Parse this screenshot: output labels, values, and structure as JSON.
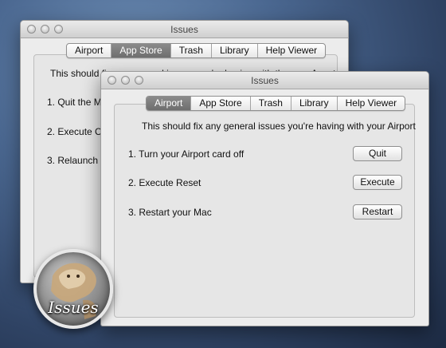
{
  "window_title": "Issues",
  "tabs": [
    "Airport",
    "App Store",
    "Trash",
    "Library",
    "Help Viewer"
  ],
  "back_window": {
    "selected_tab": "App Store",
    "description": "This should fix any general issues you're having with the mac Appstore",
    "steps": [
      "1.  Quit the Mac",
      "2.  Execute Con",
      "3.  Relaunch M"
    ]
  },
  "front_window": {
    "selected_tab": "Airport",
    "description": "This should fix any general issues you're having with your Airport",
    "steps": [
      {
        "label": "1.  Turn your Airport card off",
        "button": "Quit"
      },
      {
        "label": "2.  Execute Reset",
        "button": "Execute"
      },
      {
        "label": "3.  Restart your Mac",
        "button": "Restart"
      }
    ]
  },
  "app_icon": {
    "label": "Issues",
    "icon": "cougar-app-icon"
  },
  "colors": {
    "desktop": "#3a5378",
    "window_bg": "#ececec",
    "selected_tab_bg": "#7c7c7c"
  }
}
